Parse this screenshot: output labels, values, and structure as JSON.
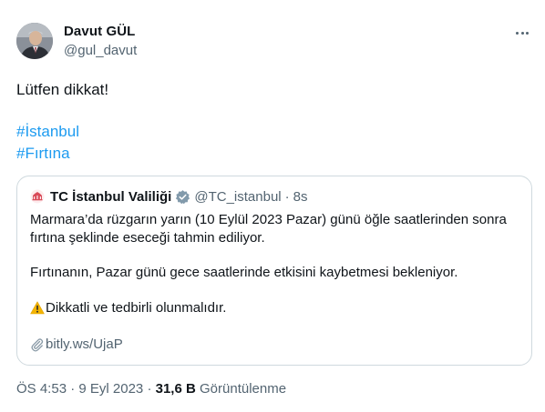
{
  "author": {
    "name": "Davut GÜL",
    "handle": "@gul_davut",
    "avatar_icon": "profile-photo"
  },
  "more_icon": "more-horizontal-icon",
  "tweet": {
    "text": "Lütfen dikkat!",
    "hashtags": [
      "#İstanbul",
      "#Fırtına"
    ]
  },
  "quoted": {
    "name": "TC İstanbul Valiliği",
    "verified_icon": "verified-badge-icon",
    "handle": "@TC_istanbul",
    "separator": "·",
    "time": "8s",
    "lines": [
      "Marmara’da rüzgarın yarın (10 Eylül 2023 Pazar) günü öğle saatlerinden sonra",
      "fırtına şeklinde eseceği tahmin ediliyor.",
      "Fırtınanın, Pazar günü gece saatlerinde etkisini kaybetmesi bekleniyor."
    ],
    "warning_text": "Dikkatli ve tedbirli olunmalıdır.",
    "warning_icon": "warning-icon",
    "link_icon": "paperclip-icon",
    "link_text": "bitly.ws/UjaP"
  },
  "meta": {
    "time": "ÖS 4:53",
    "separator": "·",
    "date": "9 Eyl 2023",
    "views": "31,6 B",
    "views_label": "Görüntülenme"
  }
}
